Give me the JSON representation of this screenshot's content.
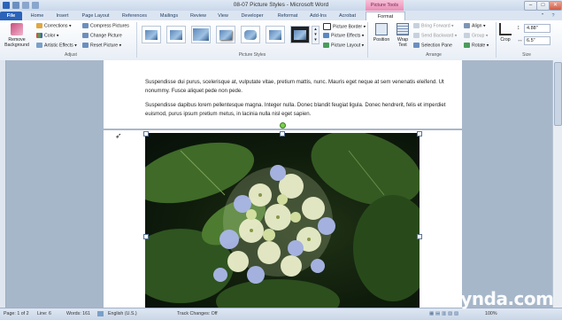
{
  "window": {
    "title": "08-07 Picture Styles - Microsoft Word",
    "context_tab": "Picture Tools",
    "controls": [
      "–",
      "□",
      "✕"
    ]
  },
  "tabs": [
    "File",
    "Home",
    "Insert",
    "Page Layout",
    "References",
    "Mailings",
    "Review",
    "View",
    "Developer",
    "Reformat",
    "Add-Ins",
    "Acrobat",
    "Format"
  ],
  "ribbon": {
    "adjust": {
      "label": "Adjust",
      "remove_bg_line1": "Remove",
      "remove_bg_line2": "Background",
      "corrections": "Corrections",
      "color": "Color",
      "artistic": "Artistic Effects",
      "compress": "Compress Pictures",
      "change": "Change Picture",
      "reset": "Reset Picture"
    },
    "styles": {
      "label": "Picture Styles",
      "border": "Picture Border",
      "effects": "Picture Effects",
      "layout": "Picture Layout"
    },
    "arrange": {
      "label": "Arrange",
      "position": "Position",
      "wrap_line1": "Wrap",
      "wrap_line2": "Text",
      "bring_forward": "Bring Forward",
      "send_backward": "Send Backward",
      "selection_pane": "Selection Pane",
      "align": "Align",
      "group": "Group",
      "rotate": "Rotate"
    },
    "size": {
      "label": "Size",
      "crop": "Crop",
      "height": "4.88\"",
      "width": "6.5\""
    }
  },
  "document": {
    "para1": "Suspendisse dui purus, scelerisque at, vulputate vitae, pretium mattis, nunc. Mauris eget neque at sem venenatis eleifend. Ut nonummy. Fusce aliquet pede non pede.",
    "para2": "Suspendisse dapibus lorem pellentesque magna. Integer nulla. Donec blandit feugiat ligula. Donec hendrerit, felis et imperdiet euismod, purus ipsum pretium metus, in lacinia nulla nisl eget sapien."
  },
  "status": {
    "page": "Page: 1 of 2",
    "line": "Line: 6",
    "words": "Words: 161",
    "language": "English (U.S.)",
    "track": "Track Changes: Off",
    "zoom": "100%"
  },
  "watermark": "lynda.com"
}
